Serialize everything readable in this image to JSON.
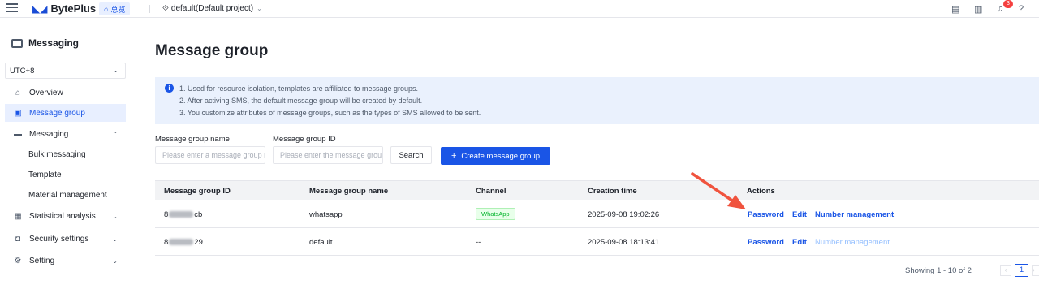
{
  "topbar": {
    "brand": "BytePlus",
    "home_tag": "总览",
    "project": "default(Default project)",
    "notification_count": "3"
  },
  "sidebar": {
    "title": "Messaging",
    "timezone": "UTC+8",
    "items": [
      {
        "label": "Overview",
        "icon": "home-icon"
      },
      {
        "label": "Message group",
        "icon": "message-group-icon",
        "active": true
      },
      {
        "label": "Messaging",
        "icon": "messaging-icon"
      },
      {
        "label": "Statistical analysis",
        "icon": "chart-icon"
      },
      {
        "label": "Security settings",
        "icon": "shield-icon"
      },
      {
        "label": "Setting",
        "icon": "gear-icon"
      }
    ],
    "sub_items": [
      "Bulk messaging",
      "Template",
      "Material management"
    ]
  },
  "main": {
    "title": "Message group",
    "info_lines": [
      "1. Used for resource isolation, templates are affiliated to message groups.",
      "2. After activing SMS, the default message group will be created by default.",
      "3. You customize attributes of message groups, such as the types of SMS allowed to be sent."
    ],
    "filters": {
      "name_label": "Message group name",
      "name_placeholder": "Please enter a message group name",
      "id_label": "Message group ID",
      "id_placeholder": "Please enter the message group ID",
      "search_label": "Search",
      "create_label": "Create message group"
    },
    "table": {
      "columns": [
        "Message group ID",
        "Message group name",
        "Channel",
        "Creation time",
        "Actions"
      ],
      "rows": [
        {
          "id_prefix": "8",
          "id_suffix": "cb",
          "name": "whatsapp",
          "channel": "WhatsApp",
          "created": "2025-09-08 19:02:26"
        },
        {
          "id_prefix": "8",
          "id_suffix": "29",
          "name": "default",
          "channel": "--",
          "created": "2025-09-08 18:13:41"
        }
      ],
      "actions": {
        "password": "Password",
        "edit": "Edit",
        "numbers": "Number management"
      }
    },
    "pagination": {
      "summary": "Showing 1 - 10 of 2",
      "page": "1"
    }
  },
  "colors": {
    "accent": "#1a55e6",
    "arrow": "#f0533e",
    "whatsapp": "#00b42a"
  }
}
